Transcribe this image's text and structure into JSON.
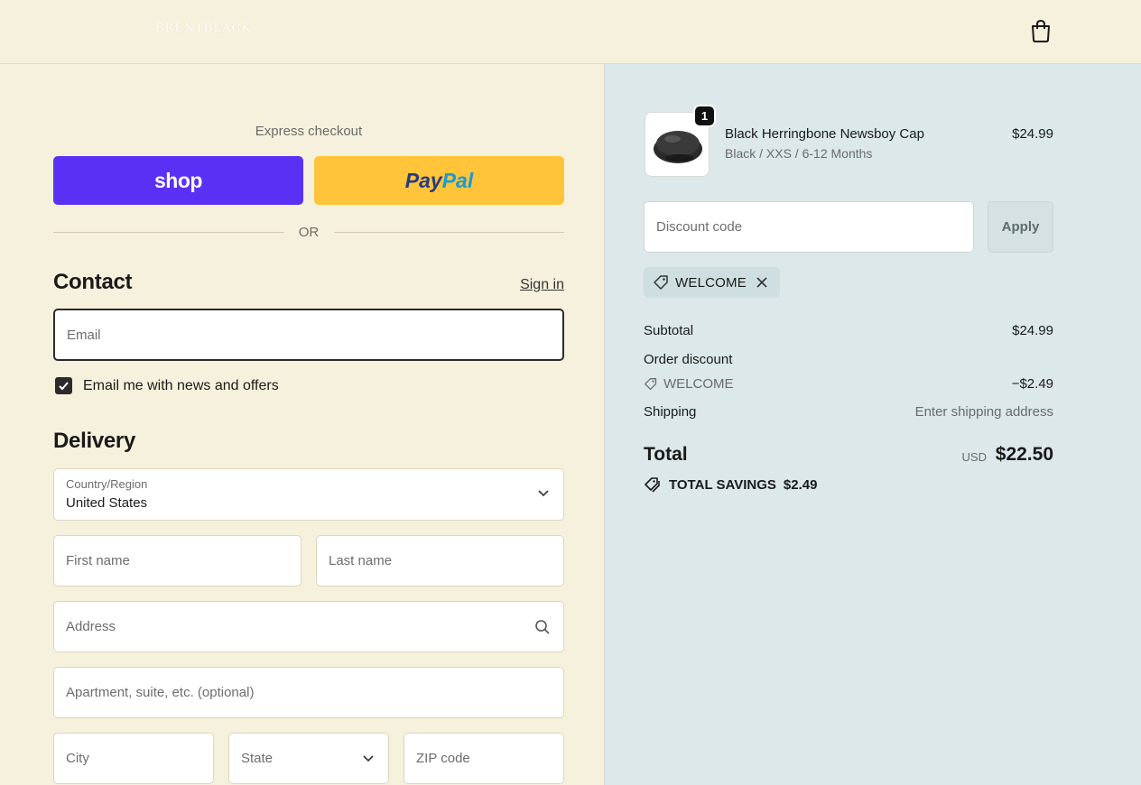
{
  "header": {
    "store_name": "BRENTBLACK",
    "cart_icon": "shopping-bag-icon"
  },
  "express": {
    "title": "Express checkout",
    "shop_label": "shop",
    "paypal_label_1": "Pay",
    "paypal_label_2": "Pal",
    "or_label": "OR"
  },
  "contact": {
    "heading": "Contact",
    "signin_label": "Sign in",
    "email_placeholder": "Email",
    "email_value": "",
    "newsletter_label": "Email me with news and offers",
    "newsletter_checked": true
  },
  "delivery": {
    "heading": "Delivery",
    "country_label": "Country/Region",
    "country_value": "United States",
    "first_name_placeholder": "First name",
    "last_name_placeholder": "Last name",
    "address_placeholder": "Address",
    "apartment_placeholder": "Apartment, suite, etc. (optional)",
    "city_placeholder": "City",
    "state_value": "State",
    "zip_placeholder": "ZIP code"
  },
  "order": {
    "item": {
      "quantity": "1",
      "name": "Black Herringbone Newsboy Cap",
      "variant": "Black / XXS / 6-12 Months",
      "price": "$24.99"
    },
    "discount_placeholder": "Discount code",
    "apply_label": "Apply",
    "applied_code": "WELCOME",
    "subtotal_label": "Subtotal",
    "subtotal_value": "$24.99",
    "order_discount_label": "Order discount",
    "order_discount_code": "WELCOME",
    "order_discount_value": "−$2.49",
    "shipping_label": "Shipping",
    "shipping_value": "Enter shipping address",
    "total_label": "Total",
    "currency": "USD",
    "total_value": "$22.50",
    "savings_label": "TOTAL SAVINGS",
    "savings_value": "$2.49"
  },
  "colors": {
    "shop_purple": "#5a31f4",
    "paypal_yellow": "#ffc439",
    "left_bg": "#f6f1dc",
    "right_bg": "#dce8e9"
  }
}
